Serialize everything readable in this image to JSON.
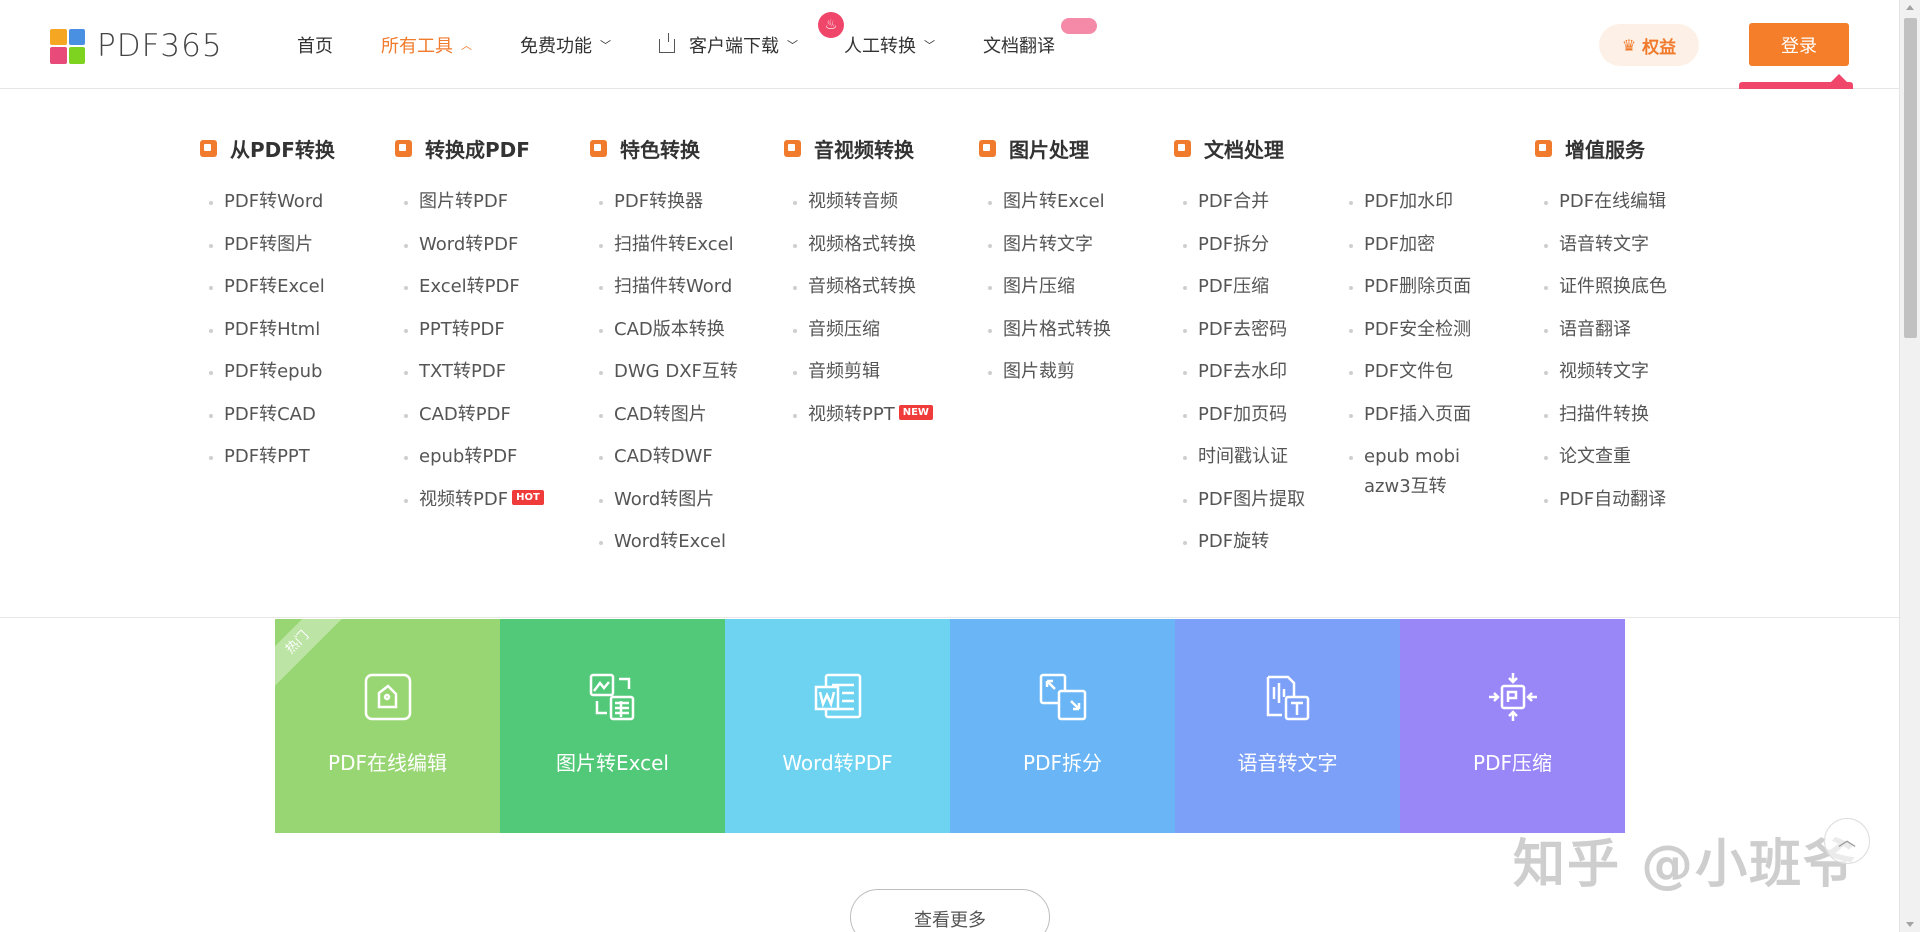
{
  "logo": {
    "text": "PDF365",
    "colors": [
      "#f5a623",
      "#4a90e2",
      "#e84a7a",
      "#7ed321"
    ]
  },
  "nav": {
    "home": "首页",
    "all_tools": "所有工具",
    "free": "免费功能",
    "client": "客户端下载",
    "manual": "人工转换",
    "translate": "文档翻译"
  },
  "header": {
    "rights": "权益",
    "login": "登录"
  },
  "menu": {
    "c1": {
      "title": "从PDF转换",
      "items": [
        "PDF转Word",
        "PDF转图片",
        "PDF转Excel",
        "PDF转Html",
        "PDF转epub",
        "PDF转CAD",
        "PDF转PPT"
      ]
    },
    "c2": {
      "title": "转换成PDF",
      "items": [
        "图片转PDF",
        "Word转PDF",
        "Excel转PDF",
        "PPT转PDF",
        "TXT转PDF",
        "CAD转PDF",
        "epub转PDF",
        "视频转PDF"
      ],
      "hot_tag": "HOT"
    },
    "c3": {
      "title": "特色转换",
      "items": [
        "PDF转换器",
        "扫描件转Excel",
        "扫描件转Word",
        "CAD版本转换",
        "DWG DXF互转",
        "CAD转图片",
        "CAD转DWF",
        "Word转图片",
        "Word转Excel"
      ]
    },
    "c4": {
      "title": "音视频转换",
      "items": [
        "视频转音频",
        "视频格式转换",
        "音频格式转换",
        "音频压缩",
        "音频剪辑",
        "视频转PPT"
      ],
      "new_tag": "NEW"
    },
    "c5": {
      "title": "图片处理",
      "items": [
        "图片转Excel",
        "图片转文字",
        "图片压缩",
        "图片格式转换",
        "图片裁剪"
      ]
    },
    "c6": {
      "title": "文档处理",
      "items": [
        "PDF合并",
        "PDF拆分",
        "PDF压缩",
        "PDF去密码",
        "PDF去水印",
        "PDF加页码",
        "时间戳认证",
        "PDF图片提取",
        "PDF旋转"
      ]
    },
    "c7": {
      "items": [
        "PDF加水印",
        "PDF加密",
        "PDF删除页面",
        "PDF安全检测",
        "PDF文件包",
        "PDF插入页面",
        "epub mobi azw3互转"
      ]
    },
    "c8": {
      "title": "增值服务",
      "items": [
        "PDF在线编辑",
        "语音转文字",
        "证件照换底色",
        "语音翻译",
        "视频转文字",
        "扫描件转换",
        "论文查重",
        "PDF自动翻译"
      ]
    }
  },
  "tiles": [
    {
      "label": "PDF在线编辑",
      "color": "#98d674",
      "icon": "edit-icon"
    },
    {
      "label": "图片转Excel",
      "color": "#52c879",
      "icon": "image-to-excel-icon"
    },
    {
      "label": "Word转PDF",
      "color": "#6dd3f0",
      "icon": "word-icon"
    },
    {
      "label": "PDF拆分",
      "color": "#6ab5f6",
      "icon": "split-icon"
    },
    {
      "label": "语音转文字",
      "color": "#7ca0f8",
      "icon": "voice-to-text-icon"
    },
    {
      "label": "PDF压缩",
      "color": "#9a87f7",
      "icon": "compress-icon"
    }
  ],
  "hot_ribbon": "热门",
  "more": "查看更多",
  "watermark": "知乎 @小班爷"
}
